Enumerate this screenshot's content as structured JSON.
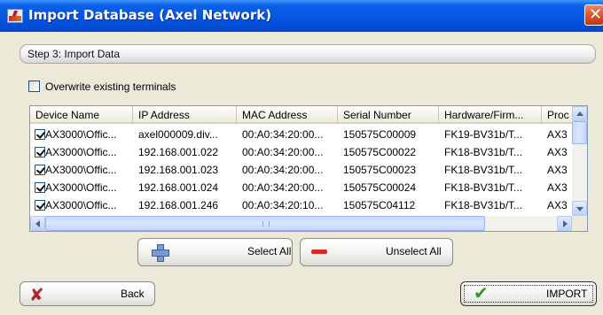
{
  "window": {
    "title": "Import Database (Axel Network)",
    "close_glyph": "✕"
  },
  "step": {
    "label": "Step 3: Import Data"
  },
  "overwrite": {
    "label": "Overwrite existing terminals",
    "checked": false
  },
  "grid": {
    "columns": [
      "Device Name",
      "IP Address",
      "MAC Address",
      "Serial Number",
      "Hardware/Firm...",
      "Proc"
    ],
    "rows": [
      [
        "AX3000\\Offic...",
        "axel000009.div...",
        "00:A0:34:20:00...",
        "150575C00009",
        "FK19-BV31b/T...",
        "AX3"
      ],
      [
        "AX3000\\Offic...",
        "192.168.001.022",
        "00:A0:34:20:00...",
        "150575C00022",
        "FK18-BV31b/T...",
        "AX3"
      ],
      [
        "AX3000\\Offic...",
        "192.168.001.023",
        "00:A0:34:20:00...",
        "150575C00023",
        "FK18-BV31b/T...",
        "AX3"
      ],
      [
        "AX3000\\Offic...",
        "192.168.001.024",
        "00:A0:34:20:00...",
        "150575C00024",
        "FK18-BV31b/T...",
        "AX3"
      ],
      [
        "AX3000\\Offic...",
        "192.168.001.246",
        "00:A0:34:20:10...",
        "150575C04112",
        "FK18-BV31b/T...",
        "AX3"
      ]
    ]
  },
  "buttons": {
    "select_all": "Select All",
    "unselect_all": "Unselect All",
    "back": "Back",
    "import": "IMPORT"
  },
  "icons": {
    "app": "axel-app-icon",
    "plus": "plus-icon",
    "minus": "minus-icon",
    "back": "x-icon",
    "import": "checkmark-icon"
  },
  "colors": {
    "titlebar": "#0554e0",
    "close": "#d2502a",
    "minus": "#d42828",
    "check": "#2e9a25",
    "x": "#b0262a"
  }
}
